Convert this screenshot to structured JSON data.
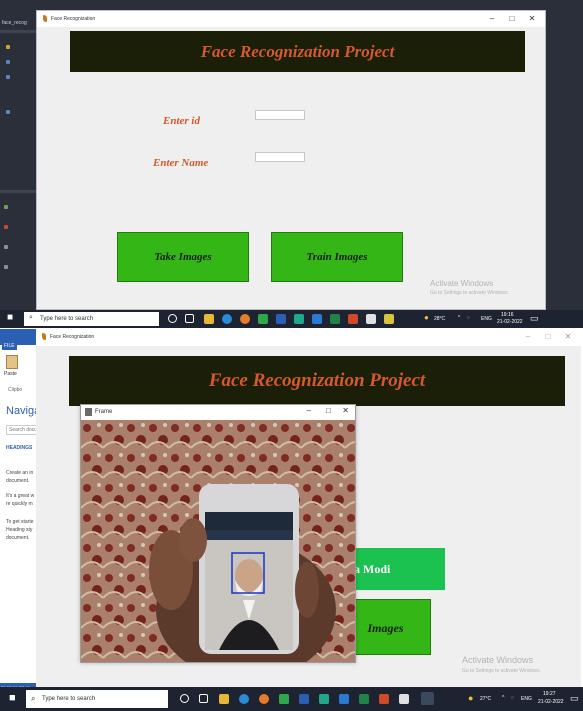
{
  "top": {
    "ide_title": "face_recog",
    "window_title": "Face Recognization",
    "banner": "Face Recognization Project",
    "id_label": "Enter id",
    "name_label": "Enter Name",
    "take_images": "Take Images",
    "train_images": "Train Images",
    "activate_title": "Activate Windows",
    "activate_sub": "Go to Settings to activate Windows."
  },
  "top_taskbar": {
    "search_placeholder": "Type here to search",
    "weather": "28°C",
    "lang": "ENG",
    "time": "19:16",
    "date": "21-02-2022"
  },
  "bottom": {
    "word": {
      "file_tab": "FILE",
      "paste_label": "Paste",
      "clipboard_label": "Clipbo",
      "nav_title": "Naviga",
      "search_doc": "Search docu",
      "headings": "HEADINGS",
      "text1": "Create an in document.",
      "text2": "It's a great w re quickly m",
      "text3": "To get starte Heading sty document.",
      "status": "PAGE 28 OF 49"
    },
    "window_title": "Face Recognization",
    "banner": "Face Recognization Project",
    "frame_title": "Frame",
    "recognized_name": "a Modi",
    "train_partial": "Images",
    "activate_title": "Activate Windows",
    "activate_sub": "Go to Settings to activate Windows."
  },
  "bottom_taskbar": {
    "search_placeholder": "Type here to search",
    "weather": "27°C",
    "lang": "ENG",
    "time": "19:27",
    "date": "21-02-2022"
  },
  "colors": {
    "banner_bg": "#1b1f08",
    "banner_text": "#d5592d",
    "button_green": "#34b617",
    "name_green": "#1bc24f"
  }
}
